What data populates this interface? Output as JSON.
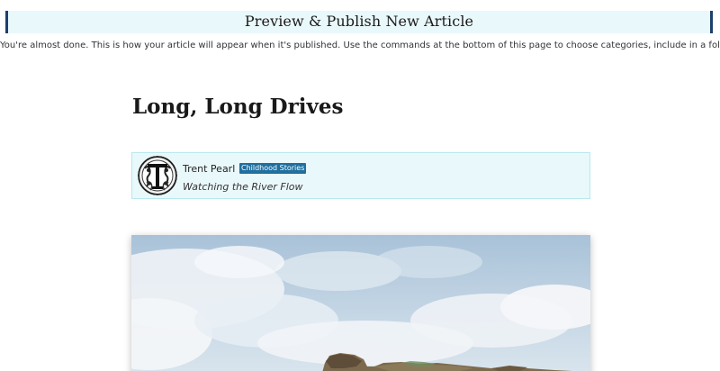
{
  "header": {
    "title": "Preview & Publish New Article"
  },
  "intro_text": "You're almost done. This is how your article will appear when it's published. Use the commands at the bottom of this page to choose categories, include in a folder and publish your article.",
  "article": {
    "title": "Long, Long Drives",
    "author": {
      "name": "Trent Pearl",
      "category": "Childhood Stories",
      "tagline": "Watching the River Flow",
      "avatar_icon": "monogram-T-avatar"
    },
    "hero_image": {
      "subject": "sky-and-cliffs-landscape"
    }
  },
  "colors": {
    "header_bg": "#e9f8fb",
    "header_border": "#1d3f6b",
    "card_bg": "#e9f8fb",
    "card_border": "#b7e8ee",
    "badge_bg": "#1f6f9f"
  }
}
